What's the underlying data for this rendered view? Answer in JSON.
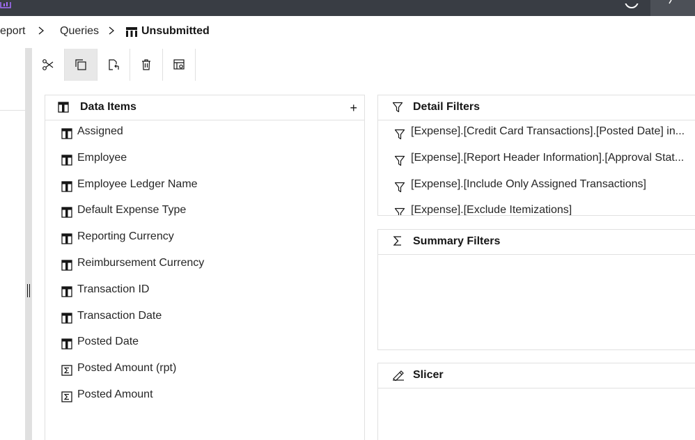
{
  "breadcrumb": {
    "items": [
      "eport",
      "Queries"
    ],
    "current": "Unsubmitted"
  },
  "toolbar": {
    "tools": [
      "cut-icon",
      "copy-icon",
      "paste-icon",
      "delete-icon",
      "query-properties-icon"
    ]
  },
  "data_items_panel": {
    "title": "Data Items",
    "add_label": "+",
    "items": [
      {
        "label": "Assigned",
        "icon": "data-item-icon"
      },
      {
        "label": "Employee",
        "icon": "data-item-icon"
      },
      {
        "label": "Employee Ledger Name",
        "icon": "data-item-icon"
      },
      {
        "label": "Default Expense Type",
        "icon": "data-item-icon"
      },
      {
        "label": "Reporting Currency",
        "icon": "data-item-icon"
      },
      {
        "label": "Reimbursement Currency",
        "icon": "data-item-icon"
      },
      {
        "label": "Transaction ID",
        "icon": "data-item-icon"
      },
      {
        "label": "Transaction Date",
        "icon": "data-item-icon"
      },
      {
        "label": "Posted Date",
        "icon": "data-item-icon"
      },
      {
        "label": "Posted Amount (rpt)",
        "icon": "sum-item-icon"
      },
      {
        "label": "Posted Amount",
        "icon": "sum-item-icon"
      }
    ]
  },
  "detail_filters_panel": {
    "title": "Detail Filters",
    "items": [
      "[Expense].[Credit Card Transactions].[Posted Date] in...",
      "[Expense].[Report Header Information].[Approval Stat...",
      "[Expense].[Include Only Assigned Transactions]",
      "[Expense].[Exclude Itemizations]"
    ]
  },
  "summary_filters_panel": {
    "title": "Summary Filters"
  },
  "slicer_panel": {
    "title": "Slicer"
  },
  "colors": {
    "topbar": "#393d44",
    "border": "#e0e0e0",
    "text": "#161616"
  }
}
